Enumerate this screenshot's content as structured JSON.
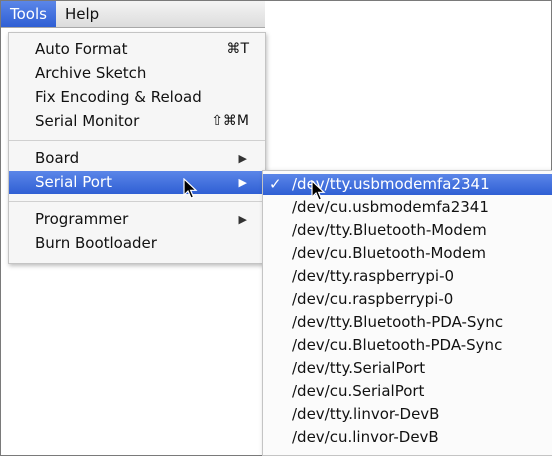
{
  "menubar": {
    "items": [
      {
        "label": "Tools"
      },
      {
        "label": "Help"
      }
    ]
  },
  "tools_menu": {
    "items": [
      {
        "label": "Auto Format",
        "shortcut": "⌘T"
      },
      {
        "label": "Archive Sketch",
        "shortcut": ""
      },
      {
        "label": "Fix Encoding & Reload",
        "shortcut": ""
      },
      {
        "label": "Serial Monitor",
        "shortcut": "⇧⌘M"
      },
      {
        "label": "Board",
        "has_submenu": true
      },
      {
        "label": "Serial Port",
        "has_submenu": true,
        "selected": true
      },
      {
        "label": "Programmer",
        "has_submenu": true
      },
      {
        "label": "Burn Bootloader",
        "shortcut": ""
      }
    ]
  },
  "serial_port_submenu": {
    "items": [
      {
        "label": "/dev/tty.usbmodemfa2341",
        "checked": true,
        "check_mark": "✓"
      },
      {
        "label": "/dev/cu.usbmodemfa2341"
      },
      {
        "label": "/dev/tty.Bluetooth-Modem"
      },
      {
        "label": "/dev/cu.Bluetooth-Modem"
      },
      {
        "label": "/dev/tty.raspberrypi-0"
      },
      {
        "label": "/dev/cu.raspberrypi-0"
      },
      {
        "label": "/dev/tty.Bluetooth-PDA-Sync"
      },
      {
        "label": "/dev/cu.Bluetooth-PDA-Sync"
      },
      {
        "label": "/dev/tty.SerialPort"
      },
      {
        "label": "/dev/cu.SerialPort"
      },
      {
        "label": "/dev/tty.linvor-DevB"
      },
      {
        "label": "/dev/cu.linvor-DevB"
      }
    ]
  },
  "icons": {
    "submenu_arrow": "triangle-right-icon",
    "pointer": "arrow-cursor-icon"
  },
  "colors": {
    "highlight": "#3467d8",
    "menu_background": "#f6f6f6"
  }
}
